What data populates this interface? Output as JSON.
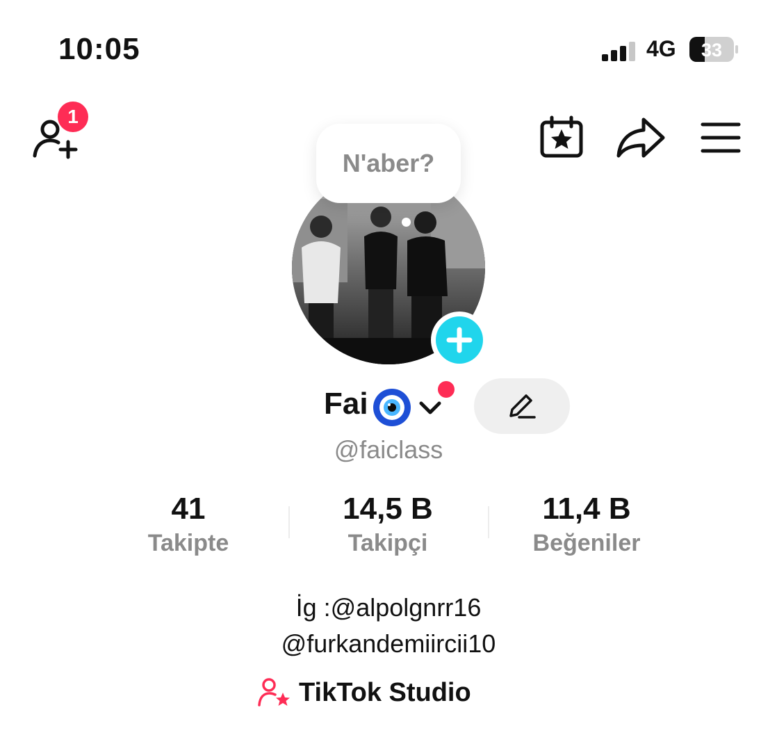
{
  "status_bar": {
    "time": "10:05",
    "network": "4G",
    "battery": "33"
  },
  "header": {
    "notification_count": "1"
  },
  "profile": {
    "note_bubble": "N'aber?",
    "display_name": "Fai",
    "username": "@faiclass"
  },
  "stats": [
    {
      "value": "41",
      "label": "Takipte"
    },
    {
      "value": "14,5 B",
      "label": "Takipçi"
    },
    {
      "value": "11,4 B",
      "label": "Beğeniler"
    }
  ],
  "bio": {
    "line1": "İg :@alpolgnrr16",
    "line2": "@furkandemiircii10"
  },
  "studio": {
    "label": "TikTok Studio"
  },
  "colors": {
    "accent_red": "#fe2c55",
    "accent_cyan": "#20d5ec",
    "secondary_text": "#8a8a8a"
  }
}
